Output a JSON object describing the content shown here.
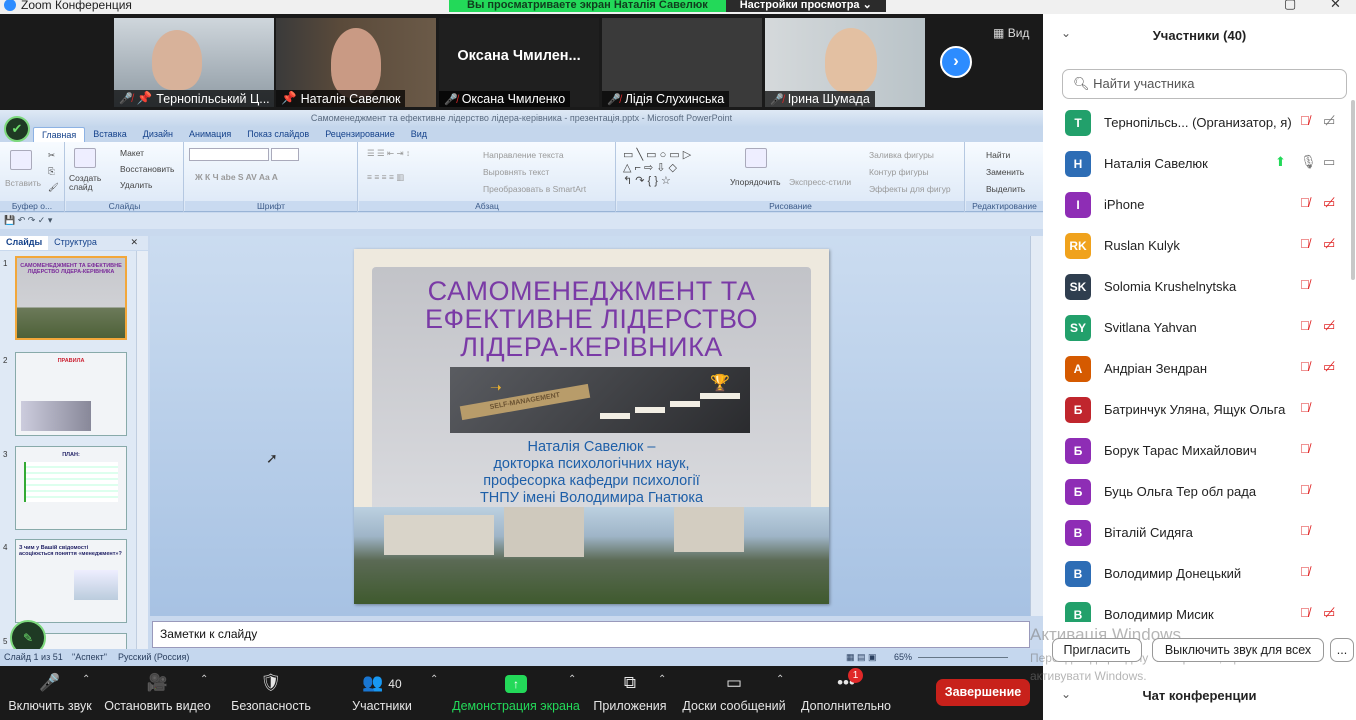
{
  "window": {
    "title": "Zoom Конференция",
    "maximize_icon": "maximize-icon",
    "close_icon": "close-icon"
  },
  "share_banner": {
    "viewing": "Вы просматриваете экран Наталія Савелюк",
    "view_options": "Настройки просмотра"
  },
  "video_strip": {
    "tiles": [
      {
        "name": "Тернопільський Ц...",
        "muted": true,
        "pinned": true
      },
      {
        "name": "Наталія Савелюк",
        "muted": false,
        "pinned": true
      },
      {
        "name": "Оксана Чмиленко",
        "muted": true,
        "big_name": "Оксана  Чмилен..."
      },
      {
        "name": "Лідія Слухинська",
        "muted": true
      },
      {
        "name": "Ірина Шумада",
        "muted": true
      }
    ],
    "view_button": "Вид"
  },
  "powerpoint": {
    "title": "Самоменеджмент та ефективне лідерство лідера-керівника - презентація.pptx - Microsoft PowerPoint",
    "tabs": [
      "Главная",
      "Вставка",
      "Дизайн",
      "Анимация",
      "Показ слайдов",
      "Рецензирование",
      "Вид"
    ],
    "ribbon": {
      "clipboard": {
        "paste": "Вставить",
        "label": "Буфер о..."
      },
      "slides": {
        "new_slide": "Создать слайд",
        "layout": "Макет",
        "reset": "Восстановить",
        "delete": "Удалить",
        "label": "Слайды"
      },
      "font": {
        "label": "Шрифт"
      },
      "paragraph": {
        "text_direction": "Направление текста",
        "align_text": "Выровнять текст",
        "smartart": "Преобразовать в SmartArt",
        "label": "Абзац"
      },
      "drawing": {
        "arrange": "Упорядочить",
        "quick_styles": "Экспресс-стили",
        "shape_fill": "Заливка фигуры",
        "shape_outline": "Контур фигуры",
        "shape_effects": "Эффекты для фигур",
        "label": "Рисование"
      },
      "editing": {
        "find": "Найти",
        "replace": "Заменить",
        "select": "Выделить",
        "label": "Редактирование"
      }
    },
    "panel_tabs": [
      "Слайды",
      "Структура"
    ],
    "thumbnails": [
      {
        "num": "1",
        "title": "САМОМЕНЕДЖМЕНТ ТА ЕФЕКТИВНЕ ЛІДЕРСТВО ЛІДЕРА-КЕРІВНИКА"
      },
      {
        "num": "2",
        "title": "ПРАВИЛА"
      },
      {
        "num": "3",
        "title": "ПЛАН:"
      },
      {
        "num": "4",
        "title": "З чим у Вашій свідомості асоціюється поняття «менеджмент»?"
      },
      {
        "num": "5",
        "title": ""
      }
    ],
    "slide": {
      "title_lines": [
        "САМОМЕНЕДЖМЕНТ ТА",
        "ЕФЕКТИВНЕ ЛІДЕРСТВО",
        "ЛІДЕРА-КЕРІВНИКА"
      ],
      "image_text": "SELF-MANAGEMENT",
      "author_lines": [
        "Наталія Савелюк –",
        "докторка психологічних наук,",
        "професорка кафедри психології",
        "ТНПУ імені Володимира Гнатюка"
      ]
    },
    "notes": "Заметки к слайду",
    "status": {
      "slide": "Слайд 1 из 51",
      "theme": "\"Аспект\"",
      "language": "Русский (Россия)",
      "zoom": "65%"
    }
  },
  "toolbar": {
    "audio": "Включить звук",
    "video": "Остановить видео",
    "security": "Безопасность",
    "participants": "Участники",
    "participants_count": "40",
    "share": "Демонстрация экрана",
    "apps": "Приложения",
    "whiteboard": "Доски сообщений",
    "more": "Дополнительно",
    "more_badge": "1",
    "end": "Завершение"
  },
  "participants_panel": {
    "title": "Участники (40)",
    "search_placeholder": "Найти участника",
    "participants": [
      {
        "initials": "T",
        "name": "Тернопільсь...  (Организатор, я)",
        "color": "#22a06b",
        "mic": "muted",
        "cam": "off-gray"
      },
      {
        "initials": "Н",
        "name": "Наталія Савелюк",
        "color": "#2d6db5",
        "mic": "on",
        "cam": "on",
        "sharing": true
      },
      {
        "initials": "I",
        "name": "iPhone",
        "color": "#8e2db5",
        "mic": "muted",
        "cam": "off"
      },
      {
        "initials": "RK",
        "name": "Ruslan Kulyk",
        "color": "#f0a21c",
        "mic": "muted",
        "cam": "off"
      },
      {
        "initials": "SK",
        "name": "Solomia Krushelnytska",
        "color": "#2f3e4f",
        "mic": "muted",
        "cam": "none"
      },
      {
        "initials": "SY",
        "name": "Svitlana Yahvan",
        "color": "#22a06b",
        "mic": "muted",
        "cam": "off"
      },
      {
        "initials": "А",
        "name": "Андріан Зендран",
        "color": "#d55a00",
        "mic": "muted",
        "cam": "off"
      },
      {
        "initials": "Б",
        "name": "Батринчук Уляна, Ящук Ольга",
        "color": "#c0262d",
        "mic": "muted",
        "cam": "none"
      },
      {
        "initials": "Б",
        "name": "Борук Тарас Михайлович",
        "color": "#8e2db5",
        "mic": "muted",
        "cam": "none"
      },
      {
        "initials": "Б",
        "name": "Буць Ольга Тер обл рада",
        "color": "#8e2db5",
        "mic": "muted",
        "cam": "none"
      },
      {
        "initials": "В",
        "name": "Віталій Сидяга",
        "color": "#8e2db5",
        "mic": "muted",
        "cam": "none"
      },
      {
        "initials": "В",
        "name": "Володимир Донецький",
        "color": "#2d6db5",
        "mic": "muted",
        "cam": "none"
      },
      {
        "initials": "В",
        "name": "Володимир Мисик",
        "color": "#22a06b",
        "mic": "muted",
        "cam": "off"
      }
    ],
    "invite": "Пригласить",
    "mute_all": "Выключить звук для всех",
    "more": "...",
    "chat_title": "Чат конференции"
  },
  "watermark": {
    "line1": "Активація Windows",
    "line2": "Перейдіть до розділу \"Настройки\", щоб",
    "line3": "активувати Windows."
  }
}
